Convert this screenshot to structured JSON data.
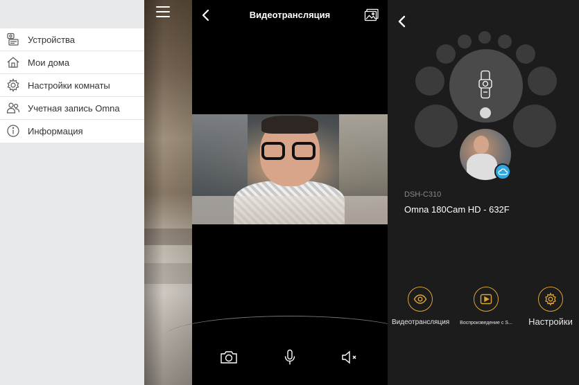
{
  "menu": {
    "items": [
      {
        "label": "Устройства",
        "icon": "devices-icon"
      },
      {
        "label": "Мои дома",
        "icon": "home-icon"
      },
      {
        "label": "Настройки комнаты",
        "icon": "gear-icon"
      },
      {
        "label": "Учетная запись Omna",
        "icon": "account-icon"
      },
      {
        "label": "Информация",
        "icon": "info-icon"
      }
    ]
  },
  "video": {
    "title": "Видеотрансляция"
  },
  "device": {
    "model": "DSH-C310",
    "name": "Omna 180Cam HD - 632F",
    "actions": [
      {
        "label": "Видеотрансляция"
      },
      {
        "label": "Воспроизведение с S..."
      },
      {
        "label": "Настройки"
      }
    ]
  },
  "colors": {
    "accent": "#e0a531",
    "cloud": "#2ea7e0"
  }
}
